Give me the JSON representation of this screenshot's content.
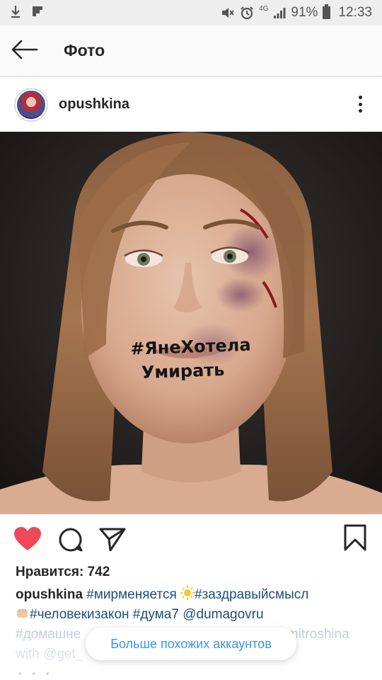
{
  "status_bar": {
    "network": "4G",
    "battery": "91%",
    "time": "12:33",
    "icons": [
      "download-icon",
      "flipboard-icon",
      "mute-icon",
      "alarm-icon",
      "signal-icon",
      "battery-icon"
    ]
  },
  "app_bar": {
    "title": "Фото",
    "back_icon": "arrow-left-icon"
  },
  "post": {
    "username": "opushkina",
    "photo_text": [
      "#ЯнеХотела",
      "Умирать"
    ],
    "likes": "Нравится: 742",
    "caption": {
      "user": "opushkina",
      "line1_tag1": "#мирменяется",
      "line1_tag2": "#заздравыйсмысл",
      "line2_tag1": "#человекизакон",
      "line2_tag2": "#дума7",
      "line2_mention": "@dumagovru",
      "line3_start": "#домашне",
      "line3_end": "mitroshina",
      "line4_start": "with @get_"
    }
  },
  "overlay": {
    "more_accounts": "Больше похожих аккаунтов"
  },
  "colors": {
    "like": "#ed4956",
    "link": "#1f4e79",
    "button_text": "#3897f0"
  }
}
